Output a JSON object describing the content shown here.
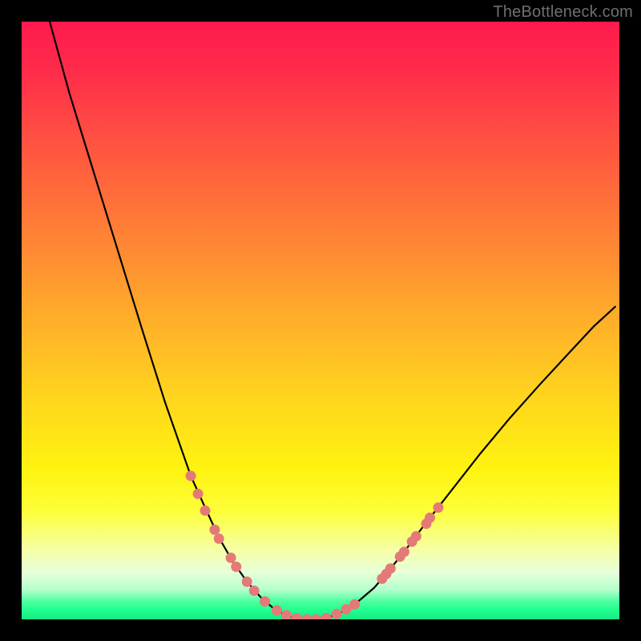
{
  "watermark": "TheBottleneck.com",
  "chart_data": {
    "type": "line",
    "title": "",
    "xlabel": "",
    "ylabel": "",
    "xlim": [
      0,
      100
    ],
    "ylim": [
      0,
      100
    ],
    "gradient_stops": [
      {
        "pos": 0,
        "color": "#ff1a4d"
      },
      {
        "pos": 16,
        "color": "#ff4545"
      },
      {
        "pos": 40,
        "color": "#ff8f32"
      },
      {
        "pos": 64,
        "color": "#ffd81c"
      },
      {
        "pos": 82,
        "color": "#fdff3a"
      },
      {
        "pos": 95,
        "color": "#b6ffce"
      },
      {
        "pos": 100,
        "color": "#18e884"
      }
    ],
    "series": [
      {
        "name": "bottleneck-curve",
        "x": [
          4.7,
          8.0,
          12.0,
          16.0,
          20.0,
          24.0,
          28.3,
          30.7,
          33.0,
          35.3,
          37.7,
          40.0,
          42.3,
          44.7,
          47.0,
          49.3,
          51.3,
          53.7,
          56.3,
          59.0,
          61.3,
          64.0,
          67.3,
          71.7,
          76.7,
          81.7,
          86.7,
          91.7,
          95.7,
          99.3
        ],
        "y": [
          100,
          88.0,
          75.0,
          62.0,
          49.0,
          36.3,
          24.0,
          18.7,
          13.7,
          9.7,
          6.3,
          3.7,
          1.7,
          0.5,
          0.0,
          0.0,
          0.3,
          1.3,
          3.0,
          5.3,
          8.0,
          11.3,
          15.7,
          21.3,
          27.7,
          33.7,
          39.3,
          44.7,
          49.0,
          52.3
        ]
      }
    ],
    "marker_clusters": [
      {
        "name": "left-cluster",
        "points": [
          {
            "x": 28.3,
            "y": 24.0
          },
          {
            "x": 29.5,
            "y": 21.0
          },
          {
            "x": 30.7,
            "y": 18.2
          },
          {
            "x": 32.3,
            "y": 15.0
          },
          {
            "x": 33.0,
            "y": 13.5
          },
          {
            "x": 35.0,
            "y": 10.3
          },
          {
            "x": 35.9,
            "y": 8.8
          },
          {
            "x": 37.7,
            "y": 6.3
          },
          {
            "x": 38.9,
            "y": 4.8
          },
          {
            "x": 40.7,
            "y": 3.0
          }
        ]
      },
      {
        "name": "bottom-cluster",
        "points": [
          {
            "x": 42.7,
            "y": 1.5
          },
          {
            "x": 44.3,
            "y": 0.7
          },
          {
            "x": 46.0,
            "y": 0.2
          },
          {
            "x": 47.7,
            "y": 0.0
          },
          {
            "x": 49.3,
            "y": 0.0
          },
          {
            "x": 51.0,
            "y": 0.2
          },
          {
            "x": 52.7,
            "y": 0.9
          },
          {
            "x": 54.3,
            "y": 1.7
          },
          {
            "x": 55.7,
            "y": 2.5
          }
        ]
      },
      {
        "name": "right-cluster",
        "points": [
          {
            "x": 60.3,
            "y": 6.8
          },
          {
            "x": 61.7,
            "y": 8.5
          },
          {
            "x": 61.0,
            "y": 7.6
          },
          {
            "x": 63.3,
            "y": 10.5
          },
          {
            "x": 64.0,
            "y": 11.3
          },
          {
            "x": 65.3,
            "y": 13.0
          },
          {
            "x": 66.0,
            "y": 13.9
          },
          {
            "x": 67.7,
            "y": 16.0
          },
          {
            "x": 68.3,
            "y": 17.0
          },
          {
            "x": 69.7,
            "y": 18.7
          }
        ]
      }
    ]
  }
}
